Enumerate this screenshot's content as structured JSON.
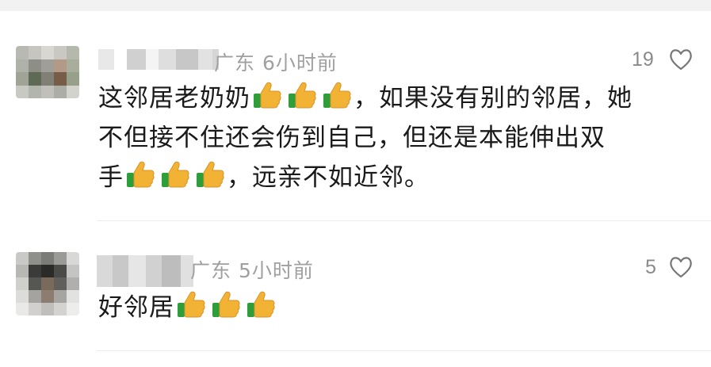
{
  "comments": [
    {
      "location_time": "广东 6小时前",
      "likes": "19",
      "line1": "这邻居老奶奶",
      "line1_tail": "，如果没有别的邻居，她",
      "line2": "不但接不住还会伤到自己，但还是本能伸出双",
      "line3_head": "手",
      "line3_tail": "，远亲不如近邻。",
      "thumb_icon": "thumbs-up-icon",
      "heart_icon": "heart-outline-icon"
    },
    {
      "location_time": "广东 5小时前",
      "likes": "5",
      "line1": "好邻居",
      "thumb_icon": "thumbs-up-icon",
      "heart_icon": "heart-outline-icon"
    }
  ],
  "colors": {
    "text": "#1a1a1a",
    "meta": "#a0a0a0",
    "divider": "#ececec",
    "thumb": "#f2b233",
    "cuff": "#2e9e3a"
  }
}
